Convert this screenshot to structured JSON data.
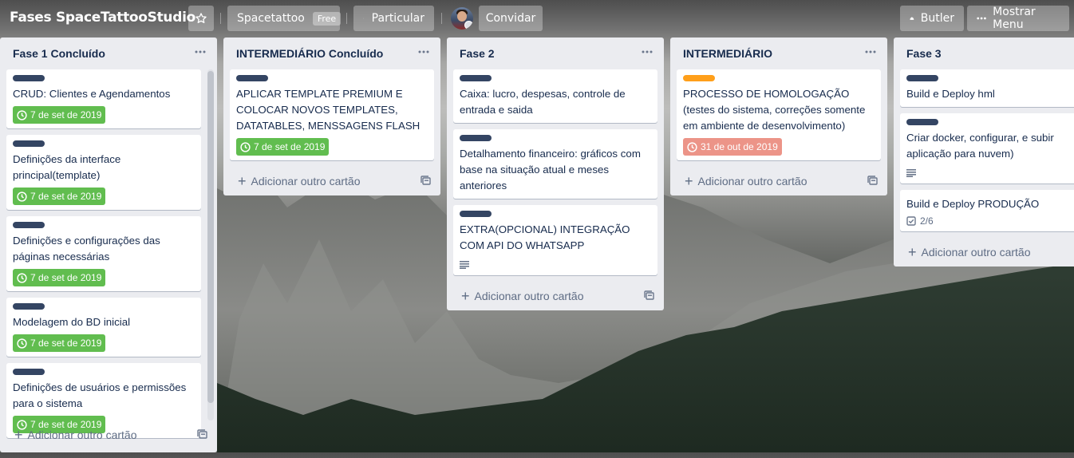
{
  "board": {
    "title": "Fases SpaceTattooStudio",
    "team_name": "Spacetattoo",
    "team_badge": "Free",
    "visibility": "Particular",
    "invite_label": "Convidar",
    "butler_label": "Butler",
    "menu_label": "Mostrar Menu"
  },
  "add_card_label": "Adicionar outro cartão",
  "colors": {
    "label_dark": "#344563",
    "label_orange": "#ff9f1a",
    "due_green": "#61bd4f",
    "due_red": "#ec9488",
    "list_bg": "#ebecf0"
  },
  "lists": [
    {
      "title": "Fase 1 Concluído",
      "cards": [
        {
          "text": "CRUD: Clientes e Agendamentos",
          "due": "7 de set de 2019"
        },
        {
          "text": "Definições da interface principal(template)",
          "due": "7 de set de 2019"
        },
        {
          "text": "Definições e configurações das páginas necessárias",
          "due": "7 de set de 2019"
        },
        {
          "text": "Modelagem do BD inicial",
          "due": "7 de set de 2019"
        },
        {
          "text": "Definições de usuários e permissões para o sistema",
          "due": "7 de set de 2019"
        }
      ]
    },
    {
      "title": "INTERMEDIÁRIO Concluído",
      "cards": [
        {
          "text": "APLICAR TEMPLATE PREMIUM E COLOCAR NOVOS TEMPLATES, DATATABLES, MENSSAGENS FLASH",
          "due": "7 de set de 2019"
        }
      ]
    },
    {
      "title": "Fase 2",
      "cards": [
        {
          "text": "Caixa: lucro, despesas, controle de entrada e saida"
        },
        {
          "text": "Detalhamento financeiro: gráficos com base na situação atual e meses anteriores"
        },
        {
          "text": "EXTRA(OPCIONAL) INTEGRAÇÃO COM API DO WHATSAPP",
          "has_description": true
        }
      ]
    },
    {
      "title": "INTERMEDIÁRIO",
      "cards": [
        {
          "text": "PROCESSO DE HOMOLOGAÇÃO (testes do sistema, correções somente em ambiente de desenvolvimento)",
          "due": "31 de out de 2019",
          "label_color": "orange",
          "due_overdue": true
        }
      ]
    },
    {
      "title": "Fase 3",
      "cards": [
        {
          "text": "Build e Deploy hml"
        },
        {
          "text": "Criar docker, configurar, e subir aplicação para nuvem)",
          "has_description": true
        },
        {
          "text": "Build e Deploy PRODUÇÃO",
          "checklist": "2/6",
          "no_label": true
        }
      ]
    }
  ]
}
